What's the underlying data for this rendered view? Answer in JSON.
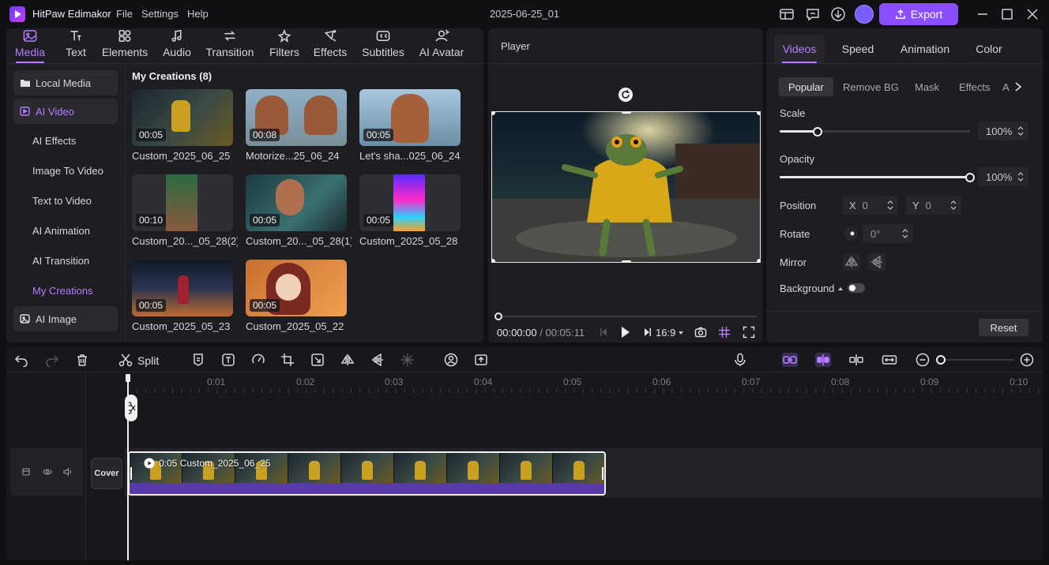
{
  "app": {
    "name": "HitPaw Edimakor",
    "menu": [
      "File",
      "Settings",
      "Help"
    ],
    "project_title": "2025-06-25_01",
    "export_label": "Export",
    "accent": "#8a4dff"
  },
  "tabs": [
    {
      "label": "Media",
      "icon": "media-icon"
    },
    {
      "label": "Text",
      "icon": "text-icon"
    },
    {
      "label": "Elements",
      "icon": "elements-icon"
    },
    {
      "label": "Audio",
      "icon": "audio-icon"
    },
    {
      "label": "Transition",
      "icon": "transition-icon"
    },
    {
      "label": "Filters",
      "icon": "filters-icon"
    },
    {
      "label": "Effects",
      "icon": "effects-icon"
    },
    {
      "label": "Subtitles",
      "icon": "subtitles-icon"
    },
    {
      "label": "AI Avatar",
      "icon": "ai-avatar-icon"
    }
  ],
  "sidebar": {
    "local_media": "Local Media",
    "ai_video": "AI Video",
    "sub": [
      "AI Effects",
      "Image To Video",
      "Text to Video",
      "AI Animation",
      "AI Transition",
      "My Creations"
    ],
    "ai_image": "AI Image"
  },
  "media": {
    "section_title": "My Creations (8)",
    "items": [
      {
        "duration": "00:05",
        "name": "Custom_2025_06_25"
      },
      {
        "duration": "00:08",
        "name": "Motorize...25_06_24"
      },
      {
        "duration": "00:05",
        "name": "Let's sha...025_06_24"
      },
      {
        "duration": "00:10",
        "name": "Custom_20..._05_28(2)"
      },
      {
        "duration": "00:05",
        "name": "Custom_20..._05_28(1)"
      },
      {
        "duration": "00:05",
        "name": "Custom_2025_05_28"
      },
      {
        "duration": "00:05",
        "name": "Custom_2025_05_23"
      },
      {
        "duration": "00:05",
        "name": "Custom_2025_05_22"
      }
    ]
  },
  "player": {
    "title": "Player",
    "current": "00:00:00",
    "total": "/ 00:05:11",
    "ratio": "16:9"
  },
  "props": {
    "tabs": [
      "Videos",
      "Speed",
      "Animation",
      "Color"
    ],
    "subtabs": [
      "Popular",
      "Remove BG",
      "Mask",
      "Effects",
      "A"
    ],
    "scale_label": "Scale",
    "scale_value": "100%",
    "scale_fraction": 0.2,
    "opacity_label": "Opacity",
    "opacity_value": "100%",
    "opacity_fraction": 1.0,
    "position_label": "Position",
    "pos_x_label": "X",
    "pos_x": "0",
    "pos_y_label": "Y",
    "pos_y": "0",
    "rotate_label": "Rotate",
    "rotate_value": "0°",
    "mirror_label": "Mirror",
    "background_label": "Background",
    "reset_label": "Reset"
  },
  "timeline": {
    "split_label": "Split",
    "ticks": [
      "0:01",
      "0:02",
      "0:03",
      "0:04",
      "0:05",
      "0:06",
      "0:07",
      "0:08",
      "0:09",
      "0:10"
    ],
    "cover_label": "Cover",
    "clip_label": "0:05 Custom_2025_06_25"
  }
}
